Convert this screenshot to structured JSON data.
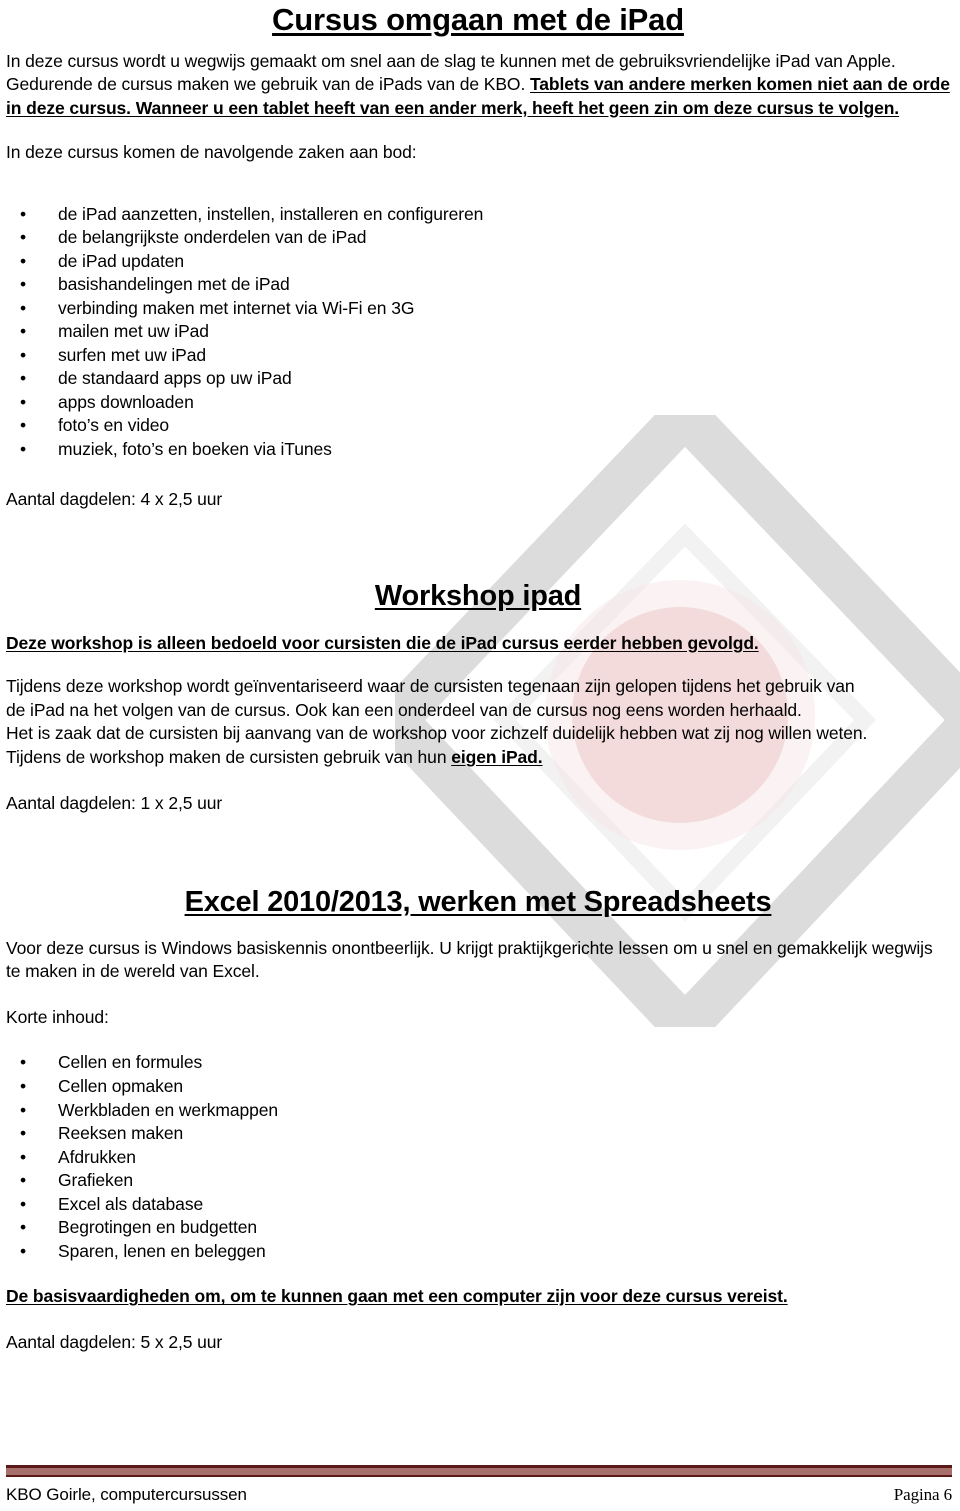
{
  "document": {
    "title": "Cursus omgaan met de iPad"
  },
  "intro": {
    "plain_part": "In deze cursus wordt u wegwijs gemaakt om snel aan de slag te kunnen met de gebruiksvriendelijke iPad van Apple. Gedurende de cursus maken we gebruik van de iPads van de KBO. ",
    "emphasis_part": "Tablets van andere merken komen niet aan de orde in deze cursus. Wanneer u een tablet heeft van een ander merk, heeft het geen zin om deze cursus te volgen."
  },
  "ipad_course": {
    "lead": "In deze cursus komen de navolgende zaken aan bod:",
    "topics": [
      "de iPad aanzetten, instellen, installeren en configureren",
      "de belangrijkste onderdelen van de iPad",
      "de iPad updaten",
      "basishandelingen met de iPad",
      "verbinding maken met internet via Wi-Fi en 3G",
      "mailen met uw iPad",
      "surfen met uw iPad",
      "de standaard apps op uw iPad",
      "apps downloaden",
      "foto’s en video",
      "muziek, foto’s en boeken via iTunes"
    ],
    "sessions": "Aantal dagdelen: 4 x 2,5 uur"
  },
  "workshop": {
    "title": "Workshop ipad",
    "notice": "Deze workshop is alleen bedoeld voor cursisten die de iPad cursus eerder hebben gevolgd.",
    "paragraph_line1": "Tijdens deze workshop wordt geïnventariseerd waar de cursisten tegenaan zijn gelopen tijdens het gebruik van",
    "paragraph_line2": "de iPad na het volgen van de cursus. Ook kan een onderdeel van de cursus nog eens worden herhaald.",
    "paragraph_line3": "Het is zaak dat de cursisten bij aanvang van de workshop voor zichzelf duidelijk hebben wat zij nog willen weten.",
    "paragraph_line4_plain": "Tijdens de workshop maken de cursisten gebruik van hun ",
    "paragraph_line4_emphasis": "eigen iPad.",
    "sessions": "Aantal dagdelen:  1 x 2,5 uur"
  },
  "excel_course": {
    "title": "Excel 2010/2013, werken met Spreadsheets",
    "intro": "Voor deze cursus is Windows basiskennis onontbeerlijk. U krijgt praktijkgerichte lessen om u snel en gemakkelijk wegwijs te maken in de wereld van Excel.",
    "contents_label": "Korte inhoud:",
    "topics": [
      "Cellen en formules",
      "Cellen opmaken",
      "Werkbladen en werkmappen",
      "Reeksen maken",
      "Afdrukken",
      "Grafieken",
      "Excel als database",
      "Begrotingen en budgetten",
      "Sparen, lenen en beleggen"
    ],
    "requirement": "De basisvaardigheden om, om te kunnen gaan met een computer zijn voor deze cursus vereist.",
    "sessions": "Aantal dagdelen: 5 x 2,5 uur"
  },
  "footer": {
    "organisation": "KBO Goirle, computercursussen",
    "page_label": "Pagina",
    "page_number": "6",
    "rule_color": "#5a1916"
  },
  "watermark": {
    "name": "diamond-logo-watermark",
    "outline_color": "#dedede",
    "accent_color": "#f0cccc"
  }
}
